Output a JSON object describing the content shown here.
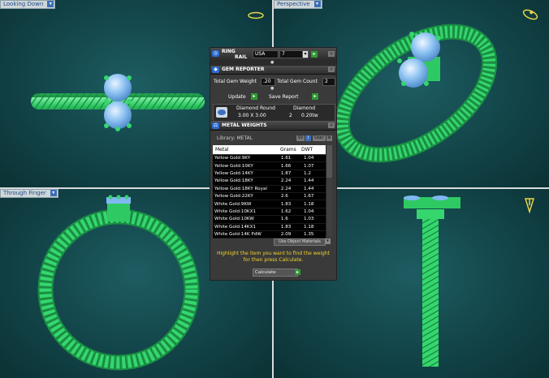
{
  "viewports": {
    "top_left": {
      "label": "Looking Down"
    },
    "top_right": {
      "label": "Perspective"
    },
    "bottom_left": {
      "label": "Through Finger"
    }
  },
  "ring_rail": {
    "title_line1": "RING",
    "title_line2": "RAIL",
    "region": "USA",
    "size": "7"
  },
  "gem_reporter": {
    "title": "GEM REPORTER",
    "total_weight_label": "Total Gem Weight",
    "total_weight_value": ".20",
    "total_count_label": "Total Gem Count",
    "total_count_value": "2",
    "update_label": "Update",
    "save_report_label": "Save Report",
    "gem": {
      "shape": "Diamond Round",
      "dimensions": "3.00 X 3.00",
      "material": "Diamond",
      "count": "2",
      "weight": "0.20tw"
    }
  },
  "metal_weights": {
    "title": "METAL WEIGHTS",
    "library_label": "Library: METAL",
    "sv_label": "SV",
    "user_label": "User",
    "columns": [
      "Metal",
      "Grams",
      "DWT"
    ],
    "rows": [
      [
        "Yellow Gold:9KY",
        "1.61",
        "1.04"
      ],
      [
        "Yellow Gold:10KY",
        "1.66",
        "1.07"
      ],
      [
        "Yellow Gold:14KY",
        "1.87",
        "1.2"
      ],
      [
        "Yellow Gold:18KY",
        "2.24",
        "1.44"
      ],
      [
        "Yellow Gold:18KY Royal",
        "2.24",
        "1.44"
      ],
      [
        "Yellow Gold:22KY",
        "2.6",
        "1.67"
      ],
      [
        "White Gold:9KW",
        "1.83",
        "1.18"
      ],
      [
        "White Gold:10KX1",
        "1.62",
        "1.04"
      ],
      [
        "White Gold:10KW",
        "1.6",
        "1.03"
      ],
      [
        "White Gold:14KX1",
        "1.83",
        "1.18"
      ],
      [
        "White Gold:14K PdW",
        "2.09",
        "1.35"
      ]
    ],
    "use_object_materials": "Use Object Materials",
    "hint": "Highlight the item you want to find the weight for then press Calculate.",
    "calculate_label": "Calculate"
  },
  "colors": {
    "ring_green": "#35d66e",
    "gem_blue": "#7fb8f0",
    "viewport_bg": "#154a4e"
  }
}
